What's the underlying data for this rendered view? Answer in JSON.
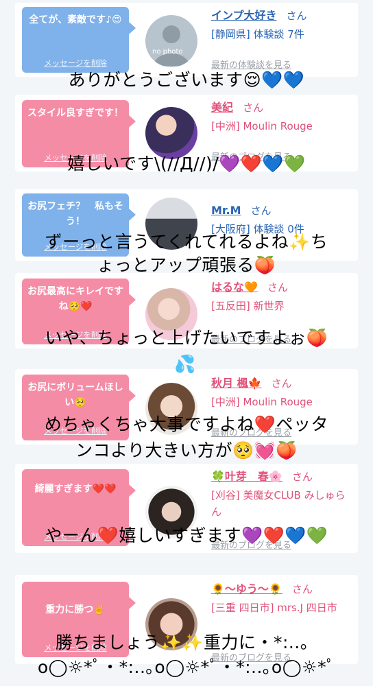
{
  "cards": [
    {
      "bubble": "全てが、素敵です♪😍",
      "delete_label": "メッセージを削除",
      "name": "インプ大好き",
      "san": "さん",
      "detail": "[静岡県] 体験談 7件",
      "more": "最新の体験談を見る",
      "avatar_text": "no photo",
      "theme": "blue"
    },
    {
      "bubble": "スタイル良すぎです！",
      "delete_label": "メッセージを削除",
      "name": "美紀",
      "san": "さん",
      "detail": "[中洲] Moulin Rouge",
      "more": "最新のブログを見る",
      "theme": "pink"
    },
    {
      "bubble": "お尻フェチ？　私もそう！",
      "delete_label": "メッセージを削除",
      "name": "Mr.M",
      "san": "さん",
      "detail": "[大阪府] 体験談 0件",
      "more": "",
      "theme": "blue"
    },
    {
      "bubble": "お尻最高にキレイですね🥺❤️",
      "delete_label": "メッセージを削除",
      "name": "はるな🧡",
      "san": "さん",
      "detail": "[五反田] 新世界",
      "more": "最新のブログを見る",
      "theme": "pink"
    },
    {
      "bubble": "お尻にボリュームほしい🥺",
      "delete_label": "メッセージを削除",
      "name": "秋月 楓🍁",
      "san": "さん",
      "detail": "[中洲] Moulin Rouge",
      "more": "最新のブログを見る",
      "theme": "pink"
    },
    {
      "bubble": "綺麗すぎます❤️❤️",
      "delete_label": "メッセージを削除",
      "name": "🍀叶芽　春🌸",
      "san": "さん",
      "detail": "[刈谷] 美魔女CLUB みしゅらん",
      "more": "最新のブログを見る",
      "theme": "pink"
    },
    {
      "bubble": "重力に勝つ✌️",
      "delete_label": "メッセージを削除",
      "name": "🌻〜ゆう〜🌻",
      "san": "さん",
      "detail": "[三重 四日市] mrs.J 四日市",
      "more": "最新のブログを見る",
      "theme": "pink"
    }
  ],
  "overlays": [
    "ありがとうございます😌💙💙",
    "嬉しいです\\(//Д//)/💜❤️💙💚",
    "ずーっと言うてくれてれるよね✨ち",
    "ょっとアップ頑張る🍑",
    "いや、ちょっと上げたいですよぉ🍑",
    "💦",
    "めちゃくちゃ大事ですよね❤️ペッタ",
    "ンコより大きい方が🥺💓🍑",
    "やーん❤️嬉しいすぎます💜❤️💙💚",
    "勝ちましょう✨✨重力に・*:..。",
    "o◯☼*ﾟ・*:..｡o◯☼*ﾟ・*:..｡o◯☼*ﾟ"
  ],
  "colors": {
    "blue_bubble": "#7fb1ea",
    "pink_bubble": "#f58ca6",
    "blue_text": "#2a64b4",
    "pink_text": "#e0527a"
  }
}
